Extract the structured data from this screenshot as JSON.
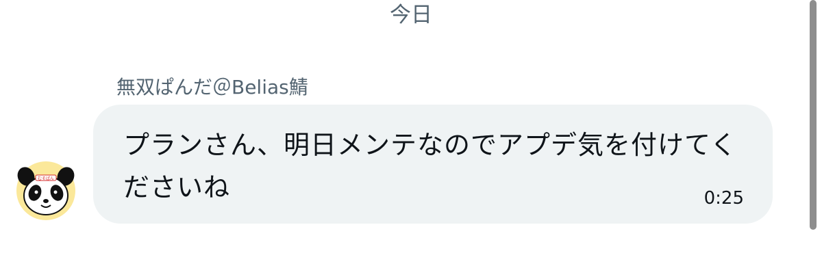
{
  "date_divider": "今日",
  "message": {
    "sender_name": "無双ぱんだ＠Belias鯖",
    "text": "プランさん、明日メンテなのでアプデ気を付けてくださいね",
    "time": "0:25"
  },
  "avatar": {
    "icon": "panda-avatar-icon",
    "badge_text": "むそぱん",
    "bg_color": "#fbe89a",
    "badge_color": "#d62b2b"
  },
  "colors": {
    "bubble_bg": "#eff3f4",
    "secondary_text": "#536471",
    "primary_text": "#0f1419"
  }
}
